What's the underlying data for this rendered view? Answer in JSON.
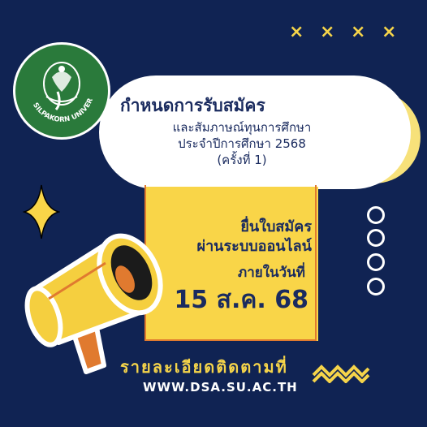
{
  "logo": {
    "text": "SILPAKORN UNIVERSITY",
    "icon": "ganesha-emblem"
  },
  "header": {
    "title": "กำหนดการรับสมัคร",
    "subtitle_lines": [
      "และสัมภาษณ์ทุนการศึกษา",
      "ประจำปีการศึกษา 2568",
      "(ครั้งที่ 1)"
    ]
  },
  "card": {
    "line1": "ยื่นใบสมัคร",
    "line2": "ผ่านระบบออนไลน์",
    "within": "ภายในวันที่",
    "date": "15 ส.ค. 68"
  },
  "footer": {
    "details": "รายละเอียดติดตามที่",
    "website": "WWW.DSA.SU.AC.TH"
  },
  "decorations": {
    "x_marks": [
      "×",
      "×",
      "×",
      "×"
    ],
    "colors": {
      "background": "#102353",
      "yellow": "#f9d548",
      "orange": "#e07a2f",
      "logo_green": "#2a7a3b",
      "text_navy": "#1a2b5f"
    }
  }
}
